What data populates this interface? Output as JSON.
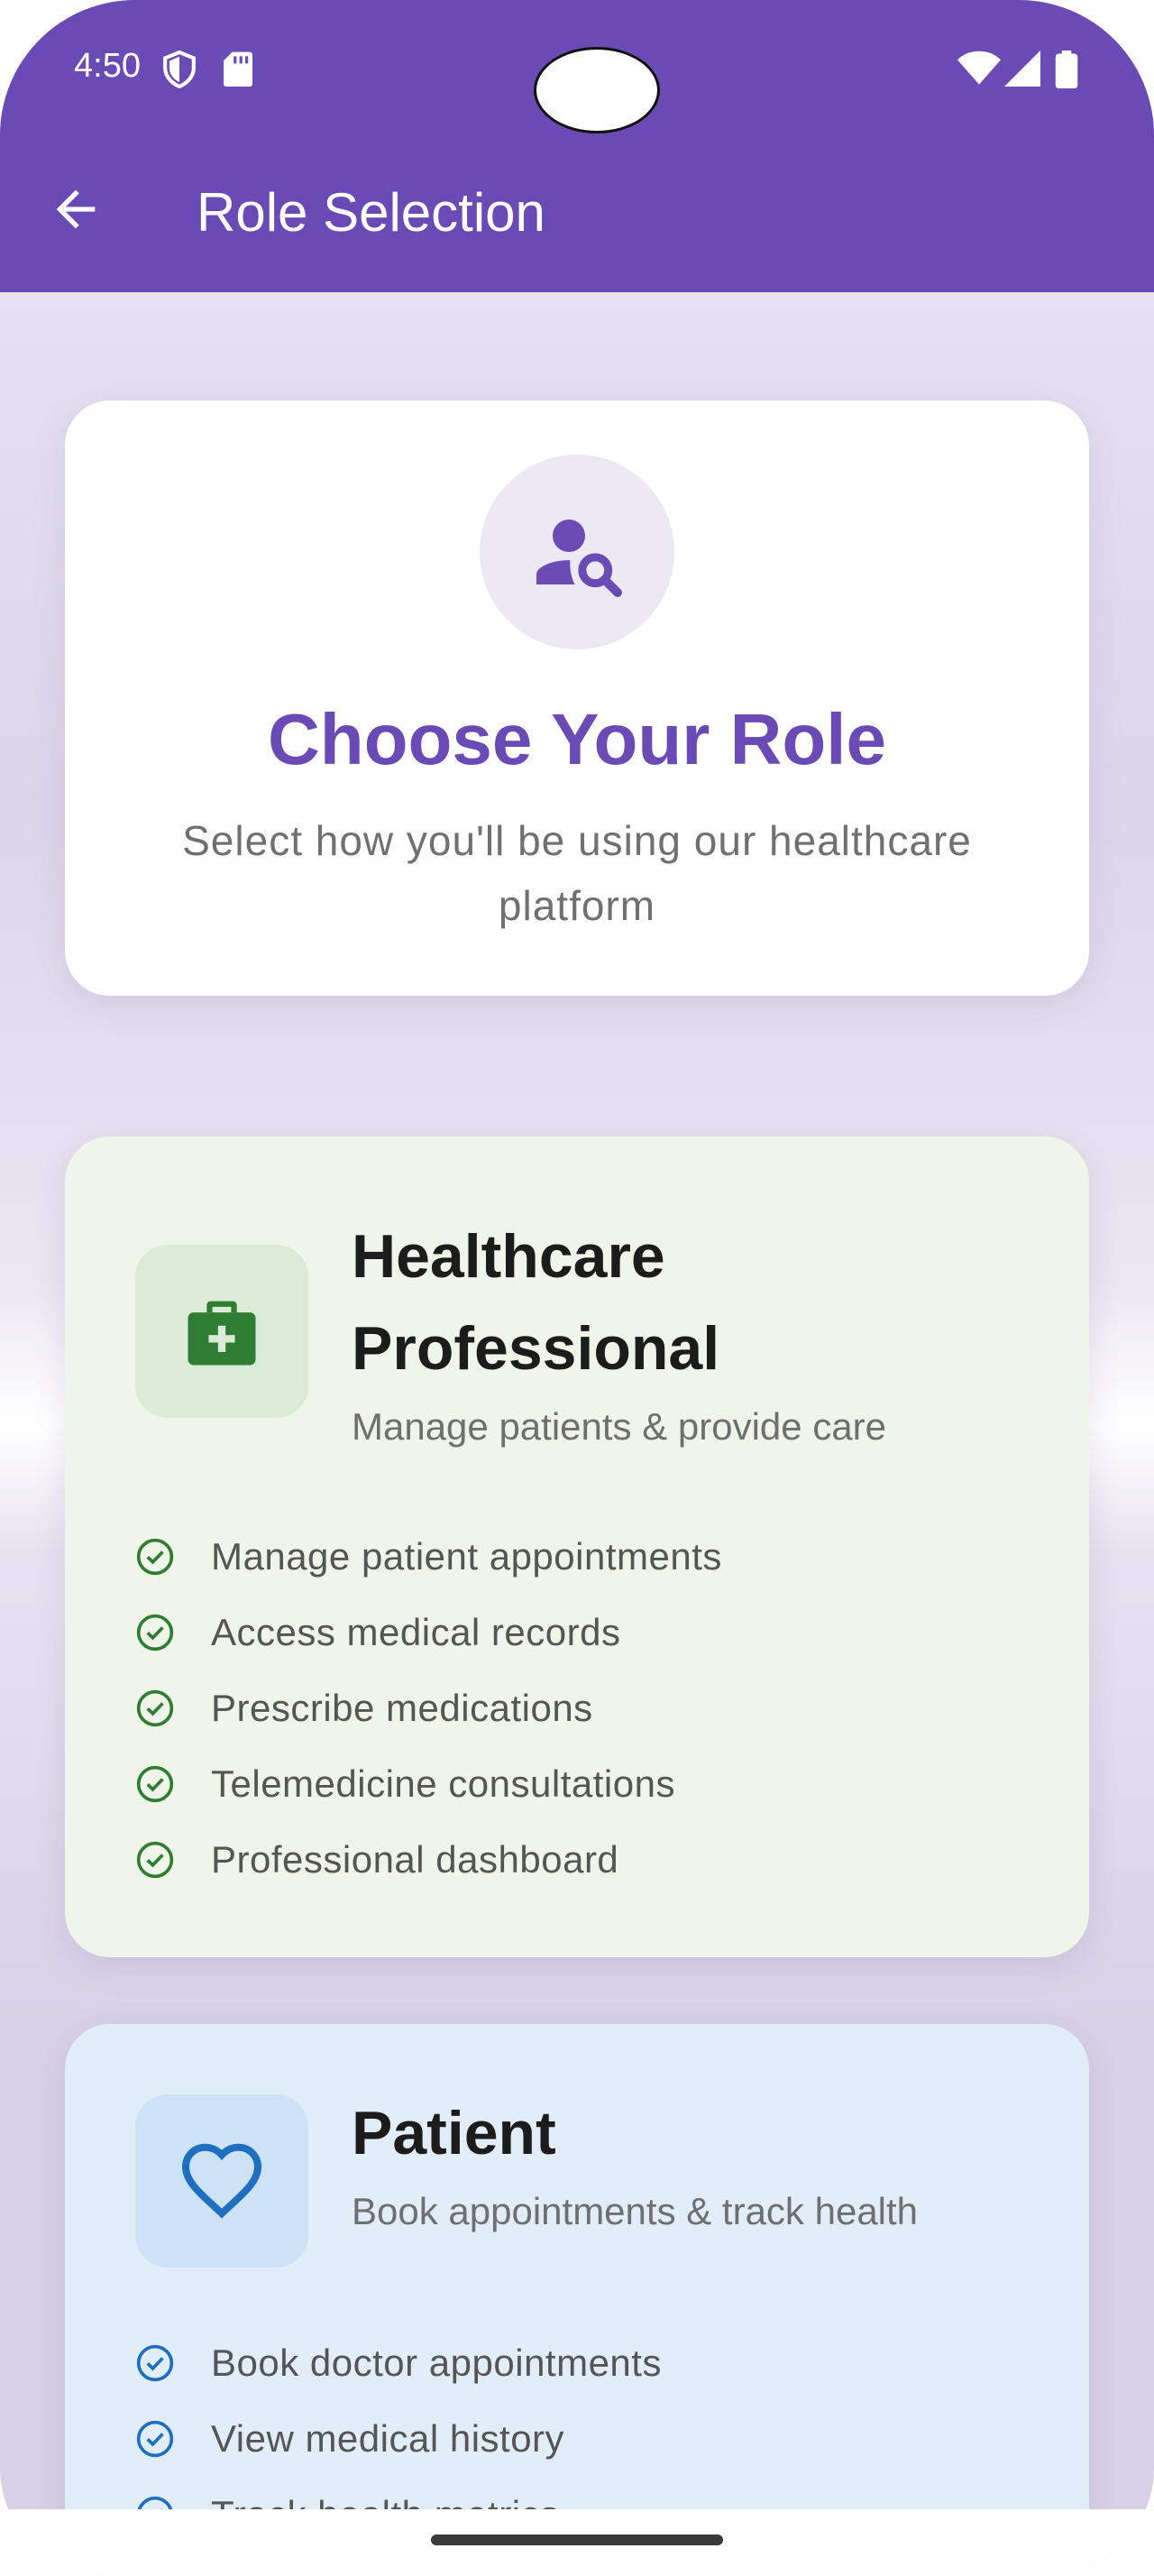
{
  "status_bar": {
    "time": "4:50",
    "icons": [
      "shield-icon",
      "sd-card-icon",
      "wifi-icon",
      "signal-icon",
      "battery-icon"
    ]
  },
  "app_bar": {
    "back_icon": "arrow-back-icon",
    "title": "Role Selection",
    "color": "#6a4bb5"
  },
  "hero": {
    "icon": "person-search-icon",
    "title": "Choose Your Role",
    "subtitle": "Select how you'll be using our healthcare platform"
  },
  "roles": [
    {
      "icon": "medical-bag-icon",
      "title": "Healthcare Professional",
      "subtitle": "Manage patients & provide care",
      "accent": "#2e7d32",
      "background": "#eff5e8",
      "features": [
        "Manage patient appointments",
        "Access medical records",
        "Prescribe medications",
        "Telemedicine consultations",
        "Professional dashboard"
      ]
    },
    {
      "icon": "heart-icon",
      "title": "Patient",
      "subtitle": "Book appointments & track health",
      "accent": "#1e6fc0",
      "background": "#e1eef9",
      "features": [
        "Book doctor appointments",
        "View medical history",
        "Track health metrics"
      ]
    }
  ]
}
